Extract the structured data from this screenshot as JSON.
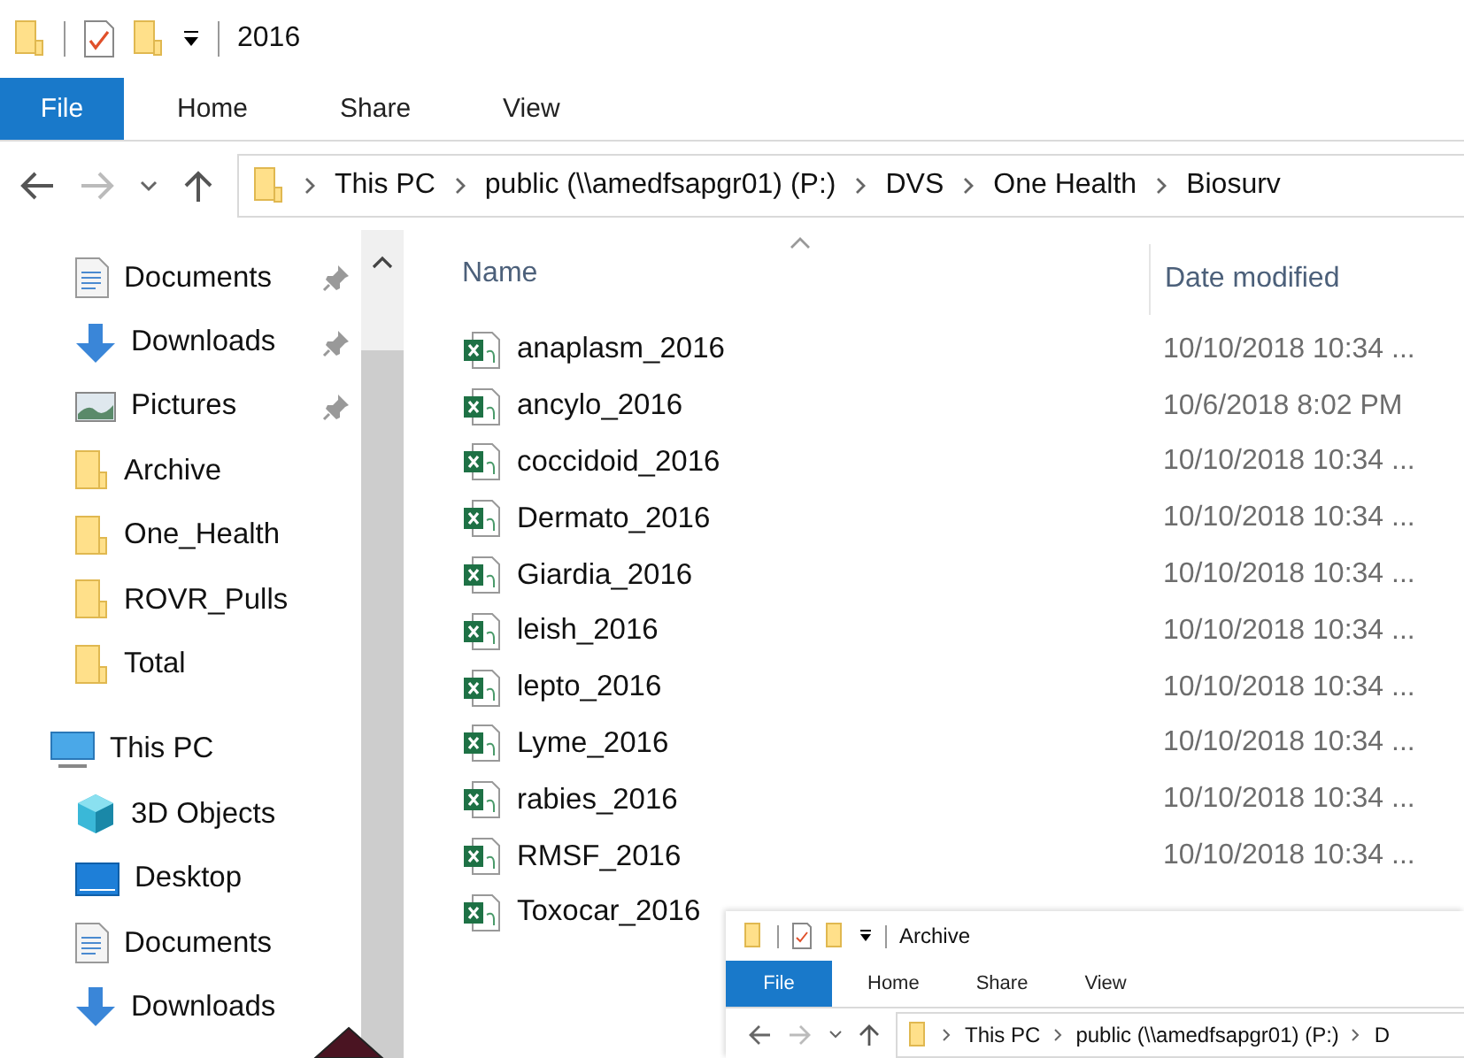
{
  "window": {
    "title": "2016"
  },
  "file_button": "File",
  "ribbon_tabs": [
    "Home",
    "Share",
    "View"
  ],
  "address": {
    "crumbs": [
      "This PC",
      "public (\\\\amedfsapgr01) (P:)",
      "DVS",
      "One Health",
      "Biosurv"
    ]
  },
  "sidebar": {
    "items": [
      {
        "label": "Documents",
        "kind": "documents",
        "pinned": true
      },
      {
        "label": "Downloads",
        "kind": "downloads",
        "pinned": true
      },
      {
        "label": "Pictures",
        "kind": "pictures",
        "pinned": true
      },
      {
        "label": "Archive",
        "kind": "folder",
        "pinned": false
      },
      {
        "label": "One_Health",
        "kind": "folder",
        "pinned": false
      },
      {
        "label": "ROVR_Pulls",
        "kind": "folder",
        "pinned": false
      },
      {
        "label": "Total",
        "kind": "folder",
        "pinned": false
      },
      {
        "label": "This PC",
        "kind": "pc",
        "pinned": false
      },
      {
        "label": "3D Objects",
        "kind": "objects",
        "pinned": false
      },
      {
        "label": "Desktop",
        "kind": "desktop",
        "pinned": false
      },
      {
        "label": "Documents",
        "kind": "documents",
        "pinned": false
      },
      {
        "label": "Downloads",
        "kind": "downloads",
        "pinned": false
      }
    ]
  },
  "columns": [
    "Name",
    "Date modified"
  ],
  "files": [
    {
      "name": "anaplasm_2016",
      "date": "10/10/2018 10:34 ..."
    },
    {
      "name": "ancylo_2016",
      "date": "10/6/2018 8:02 PM"
    },
    {
      "name": "coccidoid_2016",
      "date": "10/10/2018 10:34 ..."
    },
    {
      "name": "Dermato_2016",
      "date": "10/10/2018 10:34 ..."
    },
    {
      "name": "Giardia_2016",
      "date": "10/10/2018 10:34 ..."
    },
    {
      "name": "leish_2016",
      "date": "10/10/2018 10:34 ..."
    },
    {
      "name": "lepto_2016",
      "date": "10/10/2018 10:34 ..."
    },
    {
      "name": "Lyme_2016",
      "date": "10/10/2018 10:34 ..."
    },
    {
      "name": "rabies_2016",
      "date": "10/10/2018 10:34 ..."
    },
    {
      "name": "RMSF_2016",
      "date": "10/10/2018 10:34 ..."
    },
    {
      "name": "Toxocar_2016"
    }
  ],
  "overlay_window": {
    "title": "Archive",
    "file_button": "File",
    "ribbon_tabs": [
      "Home",
      "Share",
      "View"
    ],
    "crumbs": [
      "This PC",
      "public (\\\\amedfsapgr01) (P:)",
      "D"
    ]
  }
}
